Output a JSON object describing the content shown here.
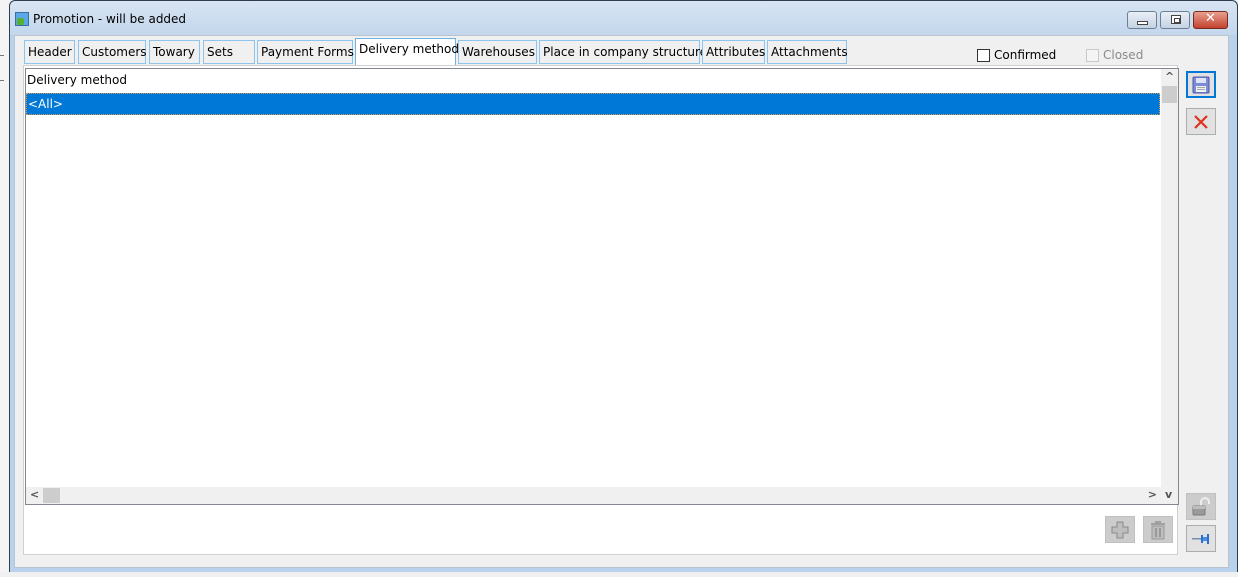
{
  "window": {
    "title": "Promotion - will be added",
    "controls": {
      "minimize": "minimize",
      "maximize": "maximize",
      "close": "✕"
    }
  },
  "tabs": [
    {
      "label": "Header",
      "active": false
    },
    {
      "label": "Customers",
      "active": false
    },
    {
      "label": "Towary",
      "active": false
    },
    {
      "label": "Sets",
      "active": false
    },
    {
      "label": "Payment Forms",
      "active": false
    },
    {
      "label": "Delivery method",
      "active": true
    },
    {
      "label": "Warehouses",
      "active": false
    },
    {
      "label": "Place in company structure",
      "active": false
    },
    {
      "label": "Attributes",
      "active": false
    },
    {
      "label": "Attachments",
      "active": false
    }
  ],
  "checkboxes": {
    "confirmed": {
      "label": "Confirmed",
      "checked": false,
      "enabled": true
    },
    "closed": {
      "label": "Closed",
      "checked": false,
      "enabled": false
    }
  },
  "grid": {
    "column_header": "Delivery method",
    "rows": [
      {
        "value": "<All>",
        "selected": true
      }
    ]
  },
  "scrollbars": {
    "up": "^",
    "down": "v",
    "left": "<",
    "right": ">"
  },
  "side_buttons": {
    "save": {
      "icon": "floppy-disk-icon"
    },
    "cancel": {
      "icon": "red-x-icon"
    },
    "unlock": {
      "icon": "padlock-open-icon"
    },
    "pin": {
      "icon": "pushpin-icon"
    }
  },
  "bottom_buttons": {
    "add": {
      "icon": "plus-icon"
    },
    "delete": {
      "icon": "trash-icon"
    }
  },
  "colors": {
    "selection": "#0078d7",
    "frame": "#b9d1ea",
    "tab_border": "#8cc4ee"
  }
}
